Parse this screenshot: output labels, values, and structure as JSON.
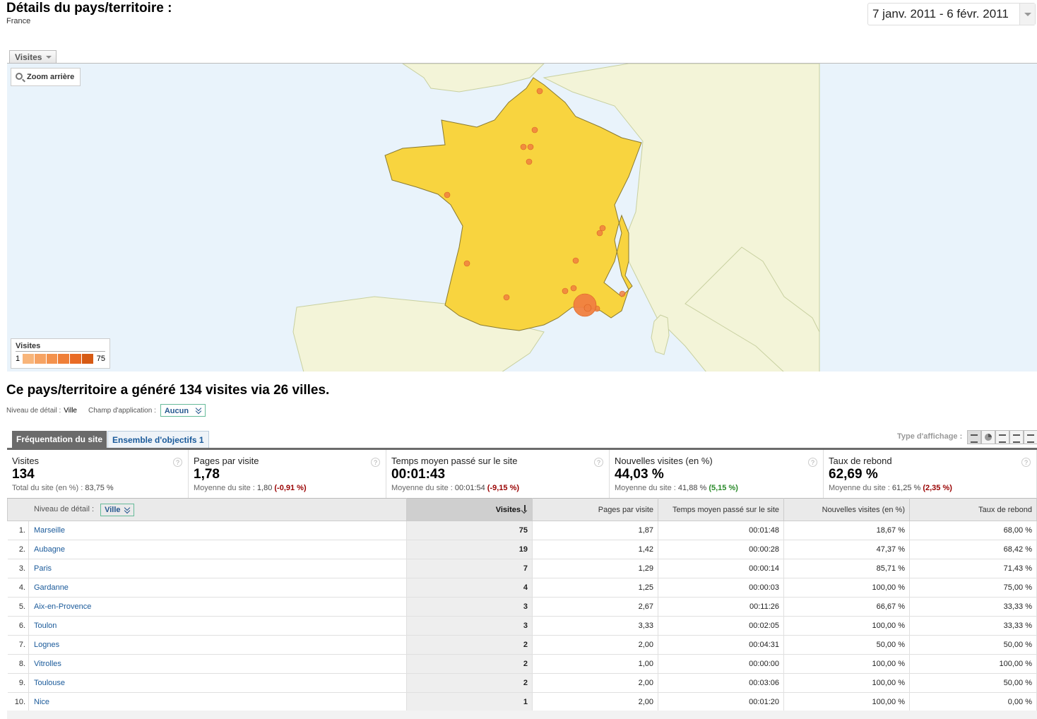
{
  "header": {
    "title": "Détails du pays/territoire :",
    "subtitle": "France",
    "date_range": "7 janv. 2011 - 6 févr. 2011"
  },
  "map": {
    "metric_select": "Visites",
    "zoom_out_label": "Zoom arrière",
    "legend": {
      "title": "Visites",
      "min": "1",
      "max": "75",
      "colors": [
        "#f8b57a",
        "#f6a363",
        "#f3924d",
        "#ef7f38",
        "#e96b25",
        "#d65a14"
      ]
    },
    "colors": {
      "country_fill": "#f8d43f",
      "land": "#f3f4d8",
      "sea": "#e9f3fb",
      "marker": "#f08040"
    }
  },
  "summary": "Ce pays/territoire a généré 134 visites via 26 villes.",
  "detail_level": {
    "label": "Niveau de détail :",
    "value": "Ville",
    "scope_label": "Champ d'application :",
    "scope_value": "Aucun"
  },
  "tabs": {
    "traffic": "Fréquentation du site",
    "goals": "Ensemble d'objectifs 1"
  },
  "view_type_label": "Type d'affichage :",
  "scorecards": [
    {
      "title": "Visites",
      "value": "134",
      "sub_label": "Total du site (en %) :",
      "sub_value": "83,75 %",
      "delta": "",
      "delta_class": ""
    },
    {
      "title": "Pages par visite",
      "value": "1,78",
      "sub_label": "Moyenne du site :",
      "sub_value": "1,80",
      "delta": "(-0,91 %)",
      "delta_class": "neg"
    },
    {
      "title": "Temps moyen passé sur le site",
      "value": "00:01:43",
      "sub_label": "Moyenne du site :",
      "sub_value": "00:01:54",
      "delta": "(-9,15 %)",
      "delta_class": "neg"
    },
    {
      "title": "Nouvelles visites (en %)",
      "value": "44,03 %",
      "sub_label": "Moyenne du site :",
      "sub_value": "41,88 %",
      "delta": "(5,15 %)",
      "delta_class": "pos"
    },
    {
      "title": "Taux de rebond",
      "value": "62,69 %",
      "sub_label": "Moyenne du site :",
      "sub_value": "61,25 %",
      "delta": "(2,35 %)",
      "delta_class": "neg"
    }
  ],
  "table": {
    "dimension_label": "Niveau de détail :",
    "dimension_value": "Ville",
    "columns": [
      "Visites",
      "Pages par visite",
      "Temps moyen passé sur le site",
      "Nouvelles visites (en %)",
      "Taux de rebond"
    ],
    "rows": [
      {
        "n": "1.",
        "city": "Marseille",
        "visits": "75",
        "ppv": "1,87",
        "time": "00:01:48",
        "new": "18,67 %",
        "bounce": "68,00 %"
      },
      {
        "n": "2.",
        "city": "Aubagne",
        "visits": "19",
        "ppv": "1,42",
        "time": "00:00:28",
        "new": "47,37 %",
        "bounce": "68,42 %"
      },
      {
        "n": "3.",
        "city": "Paris",
        "visits": "7",
        "ppv": "1,29",
        "time": "00:00:14",
        "new": "85,71 %",
        "bounce": "71,43 %"
      },
      {
        "n": "4.",
        "city": "Gardanne",
        "visits": "4",
        "ppv": "1,25",
        "time": "00:00:03",
        "new": "100,00 %",
        "bounce": "75,00 %"
      },
      {
        "n": "5.",
        "city": "Aix-en-Provence",
        "visits": "3",
        "ppv": "2,67",
        "time": "00:11:26",
        "new": "66,67 %",
        "bounce": "33,33 %"
      },
      {
        "n": "6.",
        "city": "Toulon",
        "visits": "3",
        "ppv": "3,33",
        "time": "00:02:05",
        "new": "100,00 %",
        "bounce": "33,33 %"
      },
      {
        "n": "7.",
        "city": "Lognes",
        "visits": "2",
        "ppv": "2,00",
        "time": "00:04:31",
        "new": "50,00 %",
        "bounce": "50,00 %"
      },
      {
        "n": "8.",
        "city": "Vitrolles",
        "visits": "2",
        "ppv": "1,00",
        "time": "00:00:00",
        "new": "100,00 %",
        "bounce": "100,00 %"
      },
      {
        "n": "9.",
        "city": "Toulouse",
        "visits": "2",
        "ppv": "2,00",
        "time": "00:03:06",
        "new": "100,00 %",
        "bounce": "50,00 %"
      },
      {
        "n": "10.",
        "city": "Nice",
        "visits": "1",
        "ppv": "2,00",
        "time": "00:01:20",
        "new": "100,00 %",
        "bounce": "0,00 %"
      }
    ]
  }
}
